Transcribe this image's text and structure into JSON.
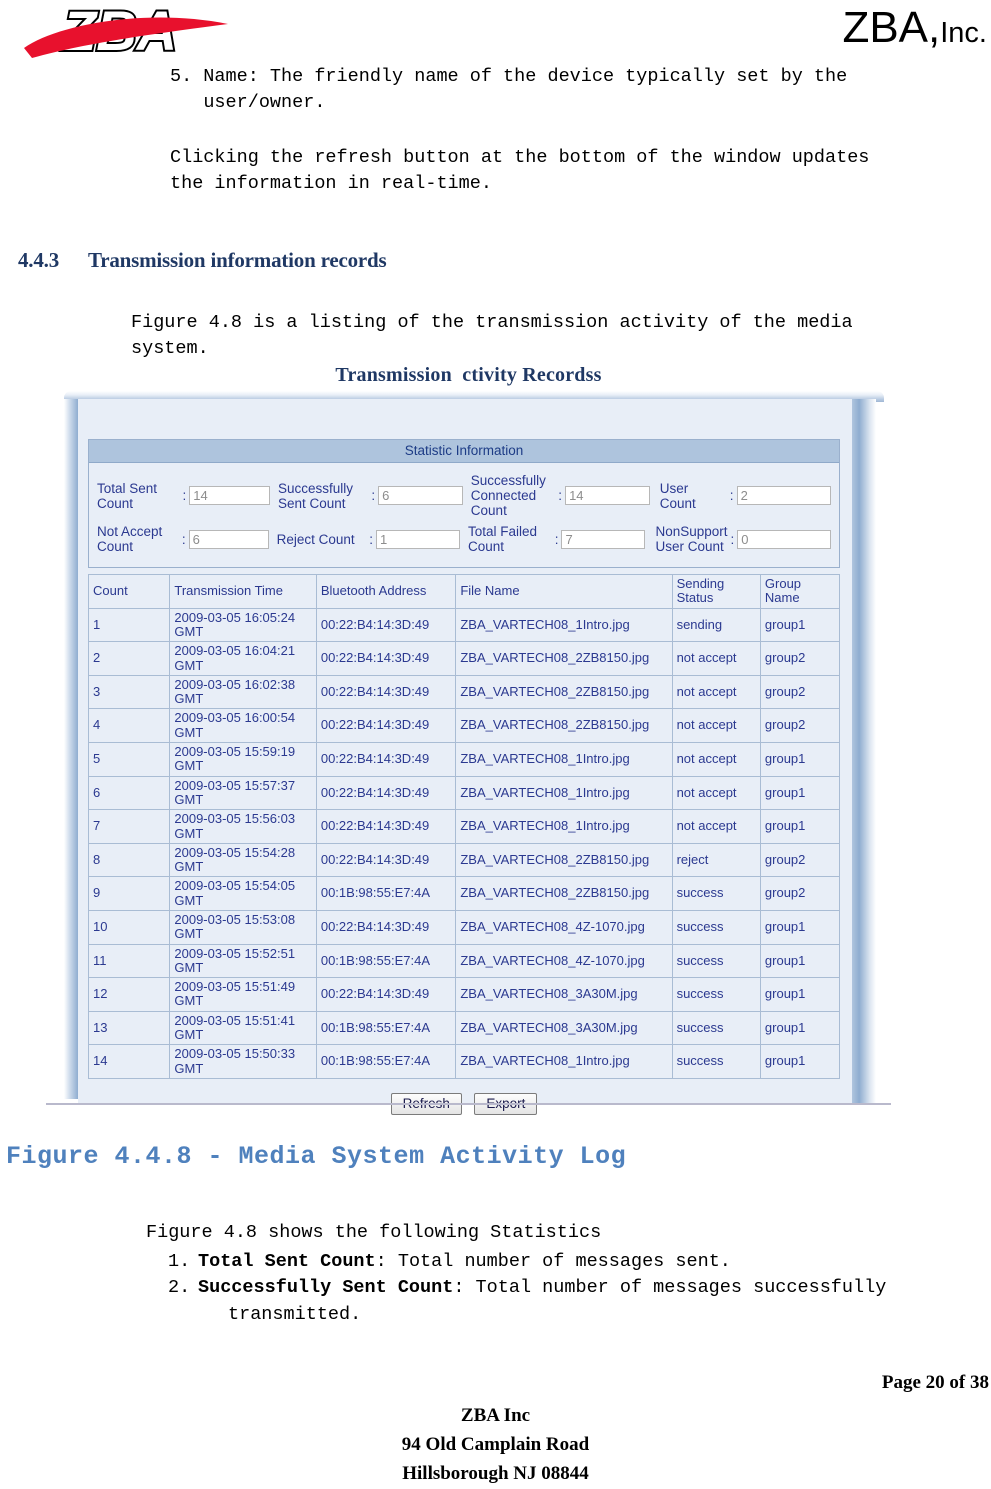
{
  "header": {
    "logo_text": "ZBA",
    "company_big": "ZBA,",
    "company_small": "Inc."
  },
  "body": {
    "para_1": "5. Name: The friendly name of the device typically set by the\n   user/owner.",
    "para_2": "Clicking the refresh button at the bottom of the window updates\nthe information in real-time.",
    "section_number": "4.4.3",
    "section_title": "Transmission information records",
    "para_3": "Figure 4.8 is a listing of the transmission activity of the media\nsystem.",
    "figure_caption": "Figure 4.4.8 - Media System Activity Log",
    "para_4": "Figure 4.8 shows the following Statistics",
    "list": [
      {
        "num": "1.",
        "term": "Total Sent Count",
        "rest": ": Total number of messages sent.",
        "cont": ""
      },
      {
        "num": "2.",
        "term": "Successfully Sent Count",
        "rest": ": Total number of messages successfully",
        "cont": "transmitted."
      }
    ]
  },
  "footer": {
    "page": "Page 20 of 38",
    "line1": "ZBA Inc",
    "line2": "94 Old Camplain Road",
    "line3": "Hillsborough NJ 08844"
  },
  "figure": {
    "title": "Transmission  ctivity Recordss",
    "stat_panel": {
      "title": "Statistic Information",
      "fields": [
        {
          "label": "Total Sent\nCount",
          "value": "14"
        },
        {
          "label": "Successfully\nSent Count",
          "value": "6"
        },
        {
          "label": "Successfully\nConnected\nCount",
          "value": "14"
        },
        {
          "label": "User Count",
          "value": "2"
        },
        {
          "label": "Not Accept\nCount",
          "value": "6"
        },
        {
          "label": "Reject Count",
          "value": "1"
        },
        {
          "label": "Total Failed\nCount",
          "value": "7"
        },
        {
          "label": "NonSupport\nUser Count",
          "value": "0"
        }
      ],
      "separator": ":"
    },
    "table": {
      "columns": [
        "Count",
        "Transmission Time",
        "Bluetooth Address",
        "File Name",
        "Sending\nStatus",
        "Group\nName"
      ],
      "rows": [
        [
          "1",
          "2009-03-05 16:05:24\nGMT",
          "00:22:B4:14:3D:49",
          "ZBA_VARTECH08_1Intro.jpg",
          "sending",
          "group1"
        ],
        [
          "2",
          "2009-03-05 16:04:21\nGMT",
          "00:22:B4:14:3D:49",
          "ZBA_VARTECH08_2ZB8150.jpg",
          "not accept",
          "group2"
        ],
        [
          "3",
          "2009-03-05 16:02:38\nGMT",
          "00:22:B4:14:3D:49",
          "ZBA_VARTECH08_2ZB8150.jpg",
          "not accept",
          "group2"
        ],
        [
          "4",
          "2009-03-05 16:00:54\nGMT",
          "00:22:B4:14:3D:49",
          "ZBA_VARTECH08_2ZB8150.jpg",
          "not accept",
          "group2"
        ],
        [
          "5",
          "2009-03-05 15:59:19\nGMT",
          "00:22:B4:14:3D:49",
          "ZBA_VARTECH08_1Intro.jpg",
          "not accept",
          "group1"
        ],
        [
          "6",
          "2009-03-05 15:57:37\nGMT",
          "00:22:B4:14:3D:49",
          "ZBA_VARTECH08_1Intro.jpg",
          "not accept",
          "group1"
        ],
        [
          "7",
          "2009-03-05 15:56:03\nGMT",
          "00:22:B4:14:3D:49",
          "ZBA_VARTECH08_1Intro.jpg",
          "not accept",
          "group1"
        ],
        [
          "8",
          "2009-03-05 15:54:28\nGMT",
          "00:22:B4:14:3D:49",
          "ZBA_VARTECH08_2ZB8150.jpg",
          "reject",
          "group2"
        ],
        [
          "9",
          "2009-03-05 15:54:05\nGMT",
          "00:1B:98:55:E7:4A",
          "ZBA_VARTECH08_2ZB8150.jpg",
          "success",
          "group2"
        ],
        [
          "10",
          "2009-03-05 15:53:08\nGMT",
          "00:22:B4:14:3D:49",
          "ZBA_VARTECH08_4Z-1070.jpg",
          "success",
          "group1"
        ],
        [
          "11",
          "2009-03-05 15:52:51\nGMT",
          "00:1B:98:55:E7:4A",
          "ZBA_VARTECH08_4Z-1070.jpg",
          "success",
          "group1"
        ],
        [
          "12",
          "2009-03-05 15:51:49\nGMT",
          "00:22:B4:14:3D:49",
          "ZBA_VARTECH08_3A30M.jpg",
          "success",
          "group1"
        ],
        [
          "13",
          "2009-03-05 15:51:41\nGMT",
          "00:1B:98:55:E7:4A",
          "ZBA_VARTECH08_3A30M.jpg",
          "success",
          "group1"
        ],
        [
          "14",
          "2009-03-05 15:50:33\nGMT",
          "00:1B:98:55:E7:4A",
          "ZBA_VARTECH08_1Intro.jpg",
          "success",
          "group1"
        ]
      ]
    },
    "buttons": {
      "refresh": "Refresh",
      "export": "Export"
    }
  },
  "colors": {
    "heading_blue": "#1f3864",
    "caption_blue": "#4f81bd",
    "table_text": "#2b3990",
    "panel_bg": "#e8eef7",
    "stat_title_bg": "#aec4dd",
    "logo_red": "#e8112d"
  }
}
